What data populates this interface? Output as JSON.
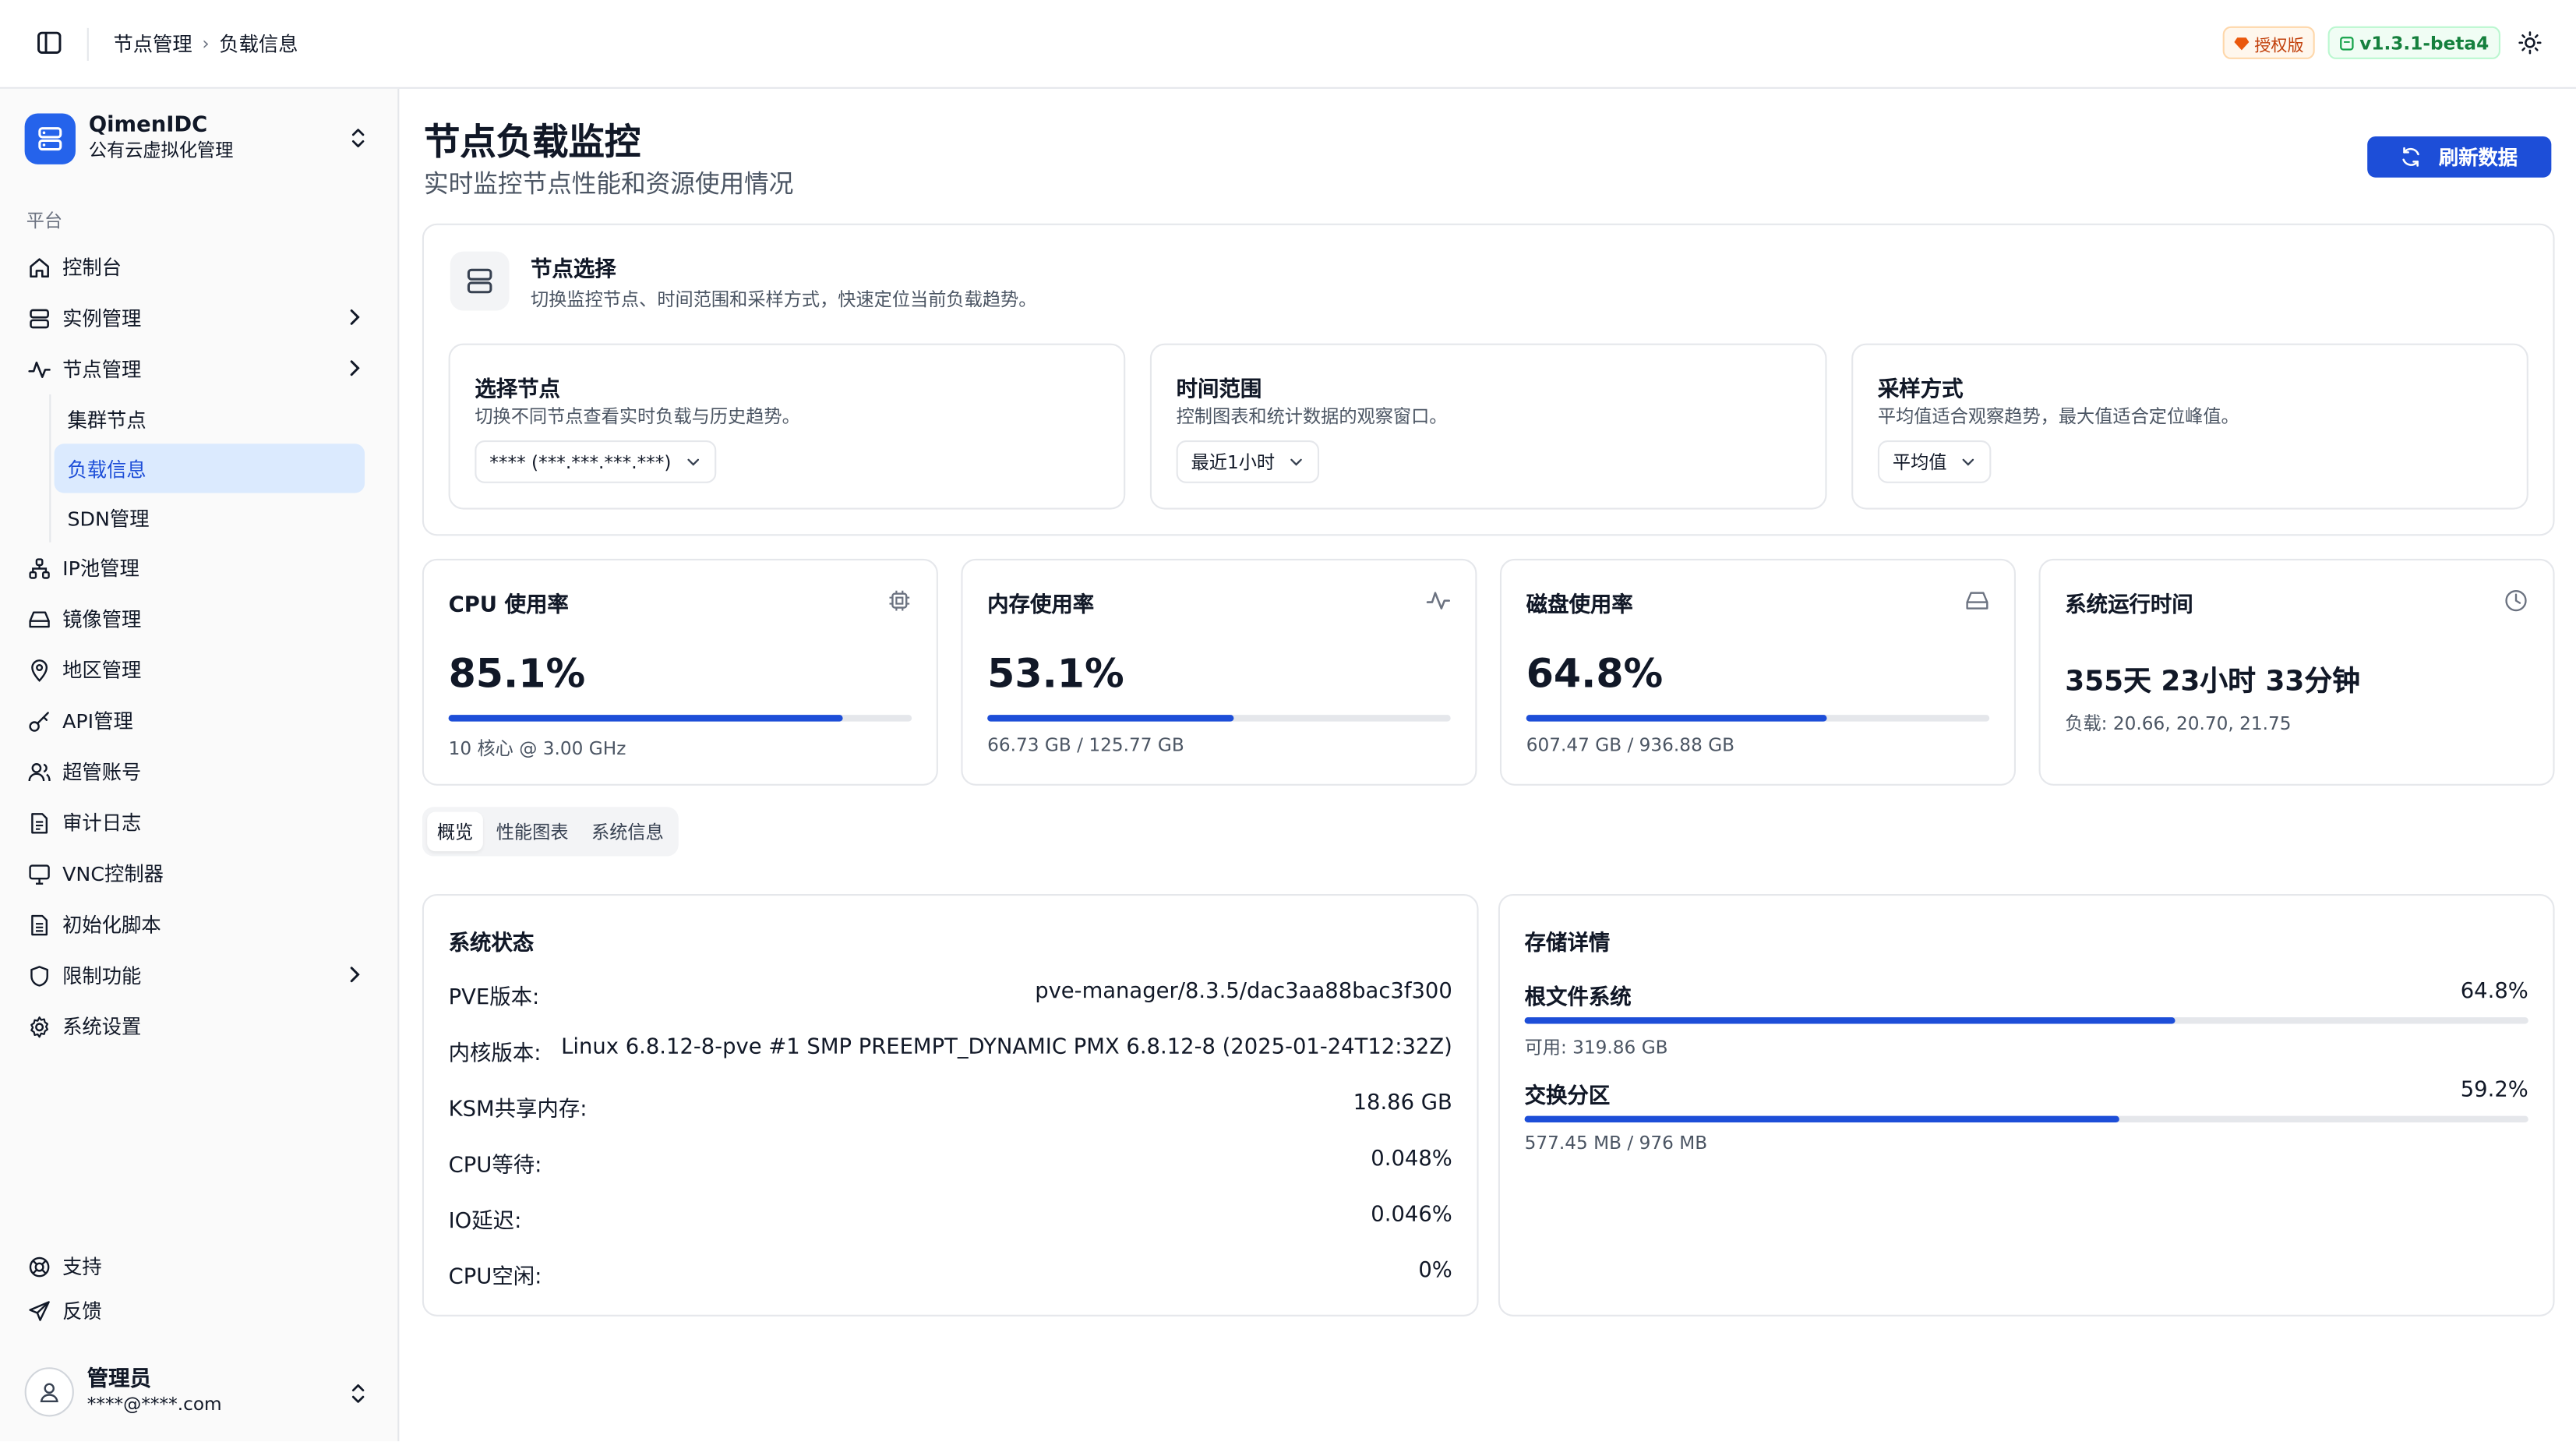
{
  "topbar": {
    "breadcrumb": [
      "节点管理",
      "负载信息"
    ],
    "license_badge": "授权版",
    "version_badge": "v1.3.1-beta4"
  },
  "sidebar": {
    "brand_name": "QimenIDC",
    "brand_sub": "公有云虚拟化管理",
    "group_label": "平台",
    "items": [
      {
        "label": "控制台",
        "icon": "home-icon"
      },
      {
        "label": "实例管理",
        "icon": "server-icon"
      },
      {
        "label": "节点管理",
        "icon": "activity-icon"
      },
      {
        "label": "IP池管理",
        "icon": "network-icon"
      },
      {
        "label": "镜像管理",
        "icon": "hard-drive-icon"
      },
      {
        "label": "地区管理",
        "icon": "map-pin-icon"
      },
      {
        "label": "API管理",
        "icon": "key-icon"
      },
      {
        "label": "超管账号",
        "icon": "users-icon"
      },
      {
        "label": "审计日志",
        "icon": "file-text-icon"
      },
      {
        "label": "VNC控制器",
        "icon": "monitor-icon"
      },
      {
        "label": "初始化脚本",
        "icon": "file-code-icon"
      },
      {
        "label": "限制功能",
        "icon": "shield-icon"
      },
      {
        "label": "系统设置",
        "icon": "gear-icon"
      }
    ],
    "sub_items": [
      "集群节点",
      "负载信息",
      "SDN管理"
    ],
    "bottom": [
      {
        "label": "支持",
        "icon": "lifebuoy-icon"
      },
      {
        "label": "反馈",
        "icon": "send-icon"
      }
    ],
    "user_name": "管理员",
    "user_email": "****@****.com"
  },
  "main": {
    "title": "节点负载监控",
    "subtitle": "实时监控节点性能和资源使用情况",
    "refresh_label": "刷新数据",
    "selector": {
      "title": "节点选择",
      "desc": "切换监控节点、时间范围和采样方式，快速定位当前负载趋势。",
      "node": {
        "title": "选择节点",
        "desc": "切换不同节点查看实时负载与历史趋势。",
        "value": "**** (***.***.***.***)"
      },
      "range": {
        "title": "时间范围",
        "desc": "控制图表和统计数据的观察窗口。",
        "value": "最近1小时"
      },
      "sample": {
        "title": "采样方式",
        "desc": "平均值适合观察趋势，最大值适合定位峰值。",
        "value": "平均值"
      }
    },
    "metrics": {
      "cpu": {
        "title": "CPU 使用率",
        "value": "85.1%",
        "percent": 85.1,
        "sub": "10 核心 @ 3.00 GHz"
      },
      "mem": {
        "title": "内存使用率",
        "value": "53.1%",
        "percent": 53.1,
        "sub": "66.73 GB / 125.77 GB"
      },
      "disk": {
        "title": "磁盘使用率",
        "value": "64.8%",
        "percent": 64.8,
        "sub": "607.47 GB / 936.88 GB"
      },
      "uptime": {
        "title": "系统运行时间",
        "value": "355天 23小时 33分钟",
        "sub": "负载: 20.66, 20.70, 21.75"
      }
    },
    "tabs": [
      "概览",
      "性能图表",
      "系统信息"
    ],
    "status": {
      "title": "系统状态",
      "rows": [
        {
          "k": "PVE版本:",
          "v": "pve-manager/8.3.5/dac3aa88bac3f300"
        },
        {
          "k": "内核版本:",
          "v": "Linux 6.8.12-8-pve #1 SMP PREEMPT_DYNAMIC PMX 6.8.12-8 (2025-01-24T12:32Z)"
        },
        {
          "k": "KSM共享内存:",
          "v": "18.86 GB"
        },
        {
          "k": "CPU等待:",
          "v": "0.048%"
        },
        {
          "k": "IO延迟:",
          "v": "0.046%"
        },
        {
          "k": "CPU空闲:",
          "v": "0%"
        }
      ]
    },
    "storage": {
      "title": "存储详情",
      "rows": [
        {
          "name": "根文件系统",
          "pct": "64.8%",
          "percent": 64.8,
          "sub": "可用: 319.86 GB"
        },
        {
          "name": "交换分区",
          "pct": "59.2%",
          "percent": 59.2,
          "sub": "577.45 MB / 976 MB"
        }
      ]
    }
  },
  "colors": {
    "accent": "#1d4ed8",
    "brand": "#2563eb"
  }
}
